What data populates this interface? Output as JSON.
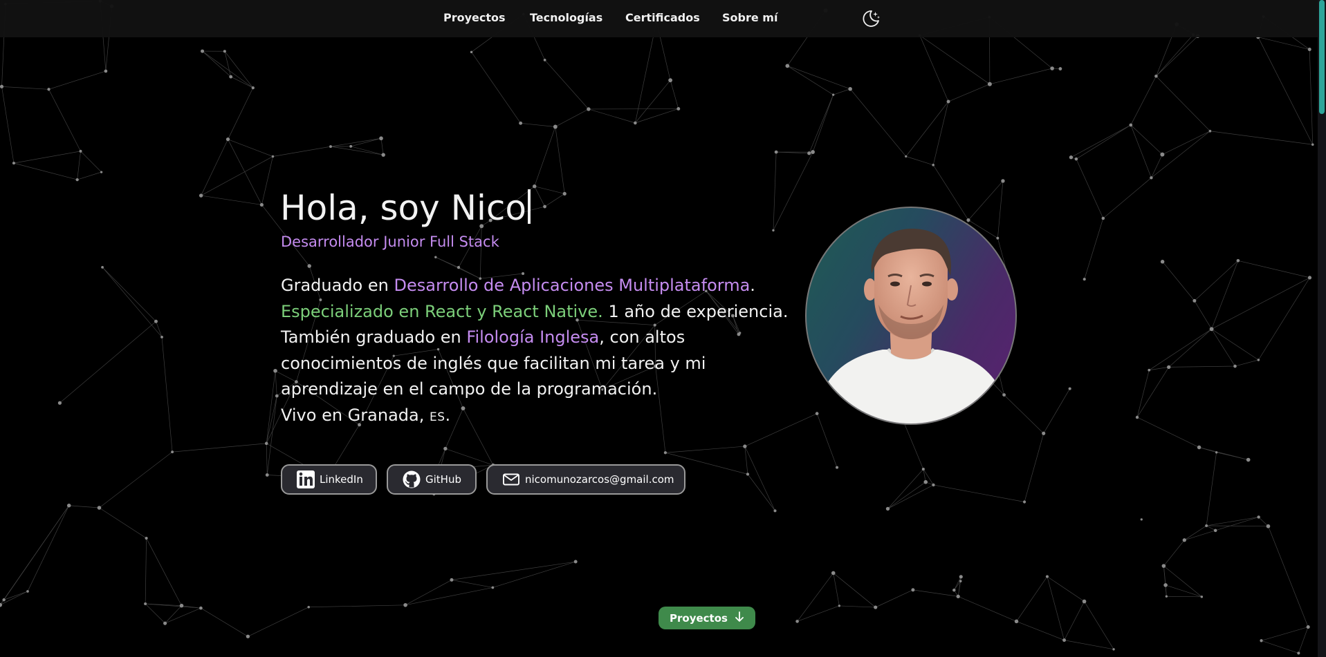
{
  "nav": {
    "items": [
      {
        "label": "Proyectos"
      },
      {
        "label": "Tecnologías"
      },
      {
        "label": "Certificados"
      },
      {
        "label": "Sobre mí"
      }
    ],
    "theme_icon": "moon-stars-icon"
  },
  "hero": {
    "title": "Hola, soy Nico",
    "subtitle": "Desarrollador Junior Full Stack",
    "bio": {
      "p1_a": "Graduado en ",
      "p1_b": "Desarrollo de Aplicaciones Multiplataforma",
      "p1_c": ".",
      "p2_a": "Especializado en React y React Native.",
      "p2_b": " 1 año de experiencia.",
      "p3_a": "También graduado en ",
      "p3_b": "Filología Inglesa",
      "p3_c": ", con altos",
      "p4": "conocimientos de inglés que facilitan mi tarea y mi",
      "p5": "aprendizaje en el campo de la programación.",
      "p6_a": "Vivo en Granada, ",
      "p6_b": "ES",
      "p6_c": "."
    },
    "highlight_colors": {
      "purple": "#c58cf0",
      "green": "#7ccf7a"
    }
  },
  "social": {
    "linkedin": {
      "label": "LinkedIn",
      "icon": "linkedin-icon"
    },
    "github": {
      "label": "GitHub",
      "icon": "github-icon"
    },
    "email": {
      "label": "nicomunozarcos@gmail.com",
      "icon": "mail-icon"
    }
  },
  "cta": {
    "label": "Proyectos",
    "icon": "arrow-down-icon",
    "color": "#3f8a4b"
  }
}
